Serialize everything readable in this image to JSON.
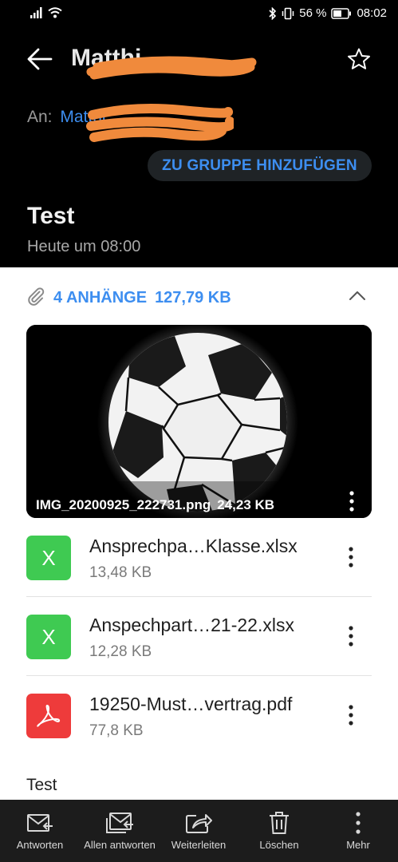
{
  "status_bar": {
    "battery_text": "56 %",
    "time": "08:02"
  },
  "header": {
    "sender_name": "Matthi",
    "to_label": "An:",
    "to_value": "Matthi",
    "group_button": "ZU GRUPPE HINZUFÜGEN",
    "subject": "Test",
    "date": "Heute um 08:00"
  },
  "attachments": {
    "count_label": "4 ANHÄNGE",
    "total_size": "127,79 KB",
    "image": {
      "name": "IMG_20200925_222731.png",
      "size": "24,23 KB"
    },
    "files": [
      {
        "icon_letter": "X",
        "name": "Ansprechpa…Klasse.xlsx",
        "size": "13,48 KB",
        "type": "excel"
      },
      {
        "icon_letter": "X",
        "name": "Anspechpart…21-22.xlsx",
        "size": "12,28 KB",
        "type": "excel"
      },
      {
        "icon_letter": "",
        "name": "19250-Must…vertrag.pdf",
        "size": "77,8 KB",
        "type": "pdf"
      }
    ]
  },
  "body": {
    "text": "Test"
  },
  "actions": [
    {
      "label": "Antworten",
      "icon": "reply-icon"
    },
    {
      "label": "Allen antworten",
      "icon": "reply-all-icon"
    },
    {
      "label": "Weiterleiten",
      "icon": "forward-icon"
    },
    {
      "label": "Löschen",
      "icon": "trash-icon"
    },
    {
      "label": "Mehr",
      "icon": "more-vertical-icon"
    }
  ],
  "colors": {
    "accent": "#3d8ef0",
    "excel": "#3fca52",
    "pdf": "#ee3b3b",
    "redaction": "#f08a3c"
  }
}
